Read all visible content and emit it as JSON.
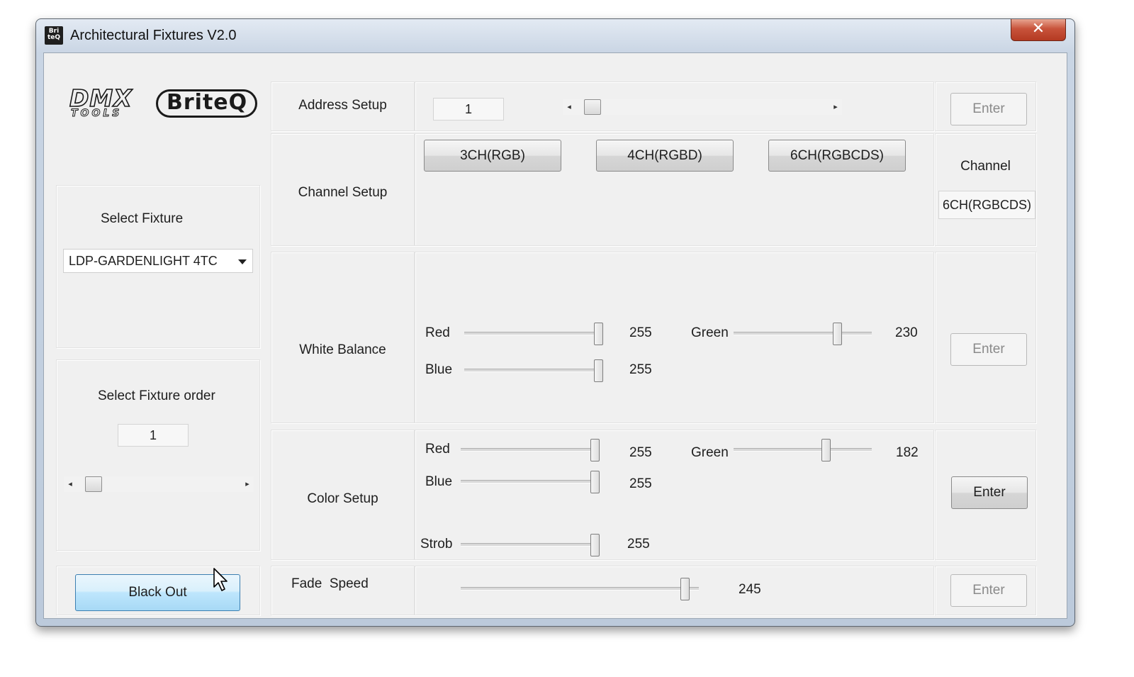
{
  "window": {
    "title": "Architectural Fixtures V2.0",
    "icon_text": "Bri teQ",
    "close_symbol": "✕"
  },
  "logos": {
    "dmx_big": "DMX",
    "dmx_small": "TOOLS",
    "briteq": "BriteQ"
  },
  "left": {
    "select_fixture_label": "Select Fixture",
    "fixture_dropdown_value": "LDP-GARDENLIGHT 4TC",
    "select_order_label": "Select Fixture order",
    "order_value": "1",
    "blackout_label": "Black Out"
  },
  "address_setup": {
    "label": "Address Setup",
    "value": "1",
    "enter_label": "Enter"
  },
  "channel_setup": {
    "label": "Channel Setup",
    "buttons": [
      "3CH(RGB)",
      "4CH(RGBD)",
      "6CH(RGBCDS)"
    ],
    "channel_heading": "Channel",
    "channel_value": "6CH(RGBCDS)"
  },
  "white_balance": {
    "label": "White Balance",
    "red_label": "Red",
    "red_value": "255",
    "red_level": 1.0,
    "green_label": "Green",
    "green_value": "230",
    "green_level": 0.77,
    "blue_label": "Blue",
    "blue_value": "255",
    "blue_level": 1.0,
    "enter_label": "Enter"
  },
  "color_setup": {
    "label": "Color Setup",
    "red_label": "Red",
    "red_value": "255",
    "red_level": 1.0,
    "green_label": "Green",
    "green_value": "182",
    "green_level": 0.68,
    "blue_label": "Blue",
    "blue_value": "255",
    "blue_level": 1.0,
    "strob_label": "Strob",
    "strob_value": "255",
    "strob_level": 1.0,
    "enter_label": "Enter"
  },
  "fade_speed": {
    "label": "Fade  Speed",
    "value": "245",
    "level": 0.96,
    "enter_label": "Enter"
  },
  "scroll_arrows": {
    "left": "◂",
    "right": "▸"
  }
}
